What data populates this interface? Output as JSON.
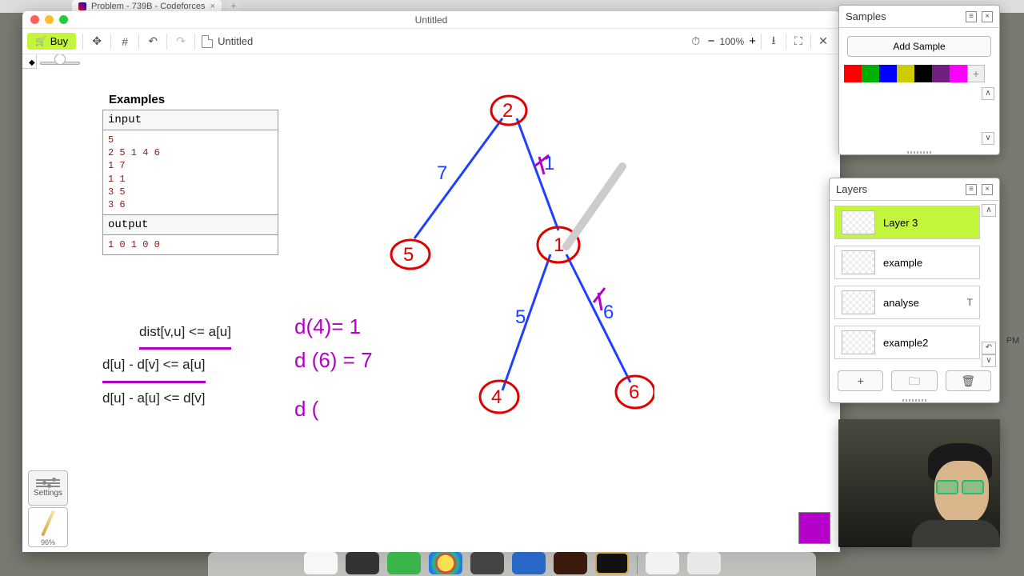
{
  "browser": {
    "tab_title": "Problem - 739B - Codeforces"
  },
  "window": {
    "title": "Untitled",
    "doc_title": "Untitled",
    "zoom": "100%"
  },
  "toolbar": {
    "buy": "Buy"
  },
  "samples": {
    "title": "Samples",
    "add_btn": "Add Sample",
    "colors": [
      "#ff0000",
      "#00c000",
      "#0000ff",
      "#d4d400",
      "#000000",
      "#802080",
      "#ff00ff"
    ]
  },
  "layers": {
    "title": "Layers",
    "items": [
      {
        "name": "Layer 3",
        "selected": true,
        "mark": ""
      },
      {
        "name": "example",
        "selected": false,
        "mark": ""
      },
      {
        "name": "analyse",
        "selected": false,
        "mark": "T"
      },
      {
        "name": "example2",
        "selected": false,
        "mark": ""
      }
    ]
  },
  "examples": {
    "heading": "Examples",
    "input_label": "input",
    "input_text": "5\n2 5 1 4 6\n1 7\n1 1\n3 5\n3 6",
    "output_label": "output",
    "output_text": "1 0 1 0 0"
  },
  "formulas": {
    "l1": "dist[v,u] <= a[u]",
    "l2": "d[u] - d[v] <= a[u]",
    "l3": "d[u] - a[u] <= d[v]"
  },
  "handwritten": {
    "eq1": "d(4)= 1",
    "eq2": "d (6) = 7",
    "eq3": "d ("
  },
  "diagram": {
    "nodes": [
      "2",
      "5",
      "1",
      "4",
      "6"
    ],
    "edge_labels": [
      "7",
      "1",
      "5",
      "6"
    ]
  },
  "settings": {
    "label": "Settings"
  },
  "pen": {
    "percent": "96%"
  },
  "edge_time": "PM"
}
